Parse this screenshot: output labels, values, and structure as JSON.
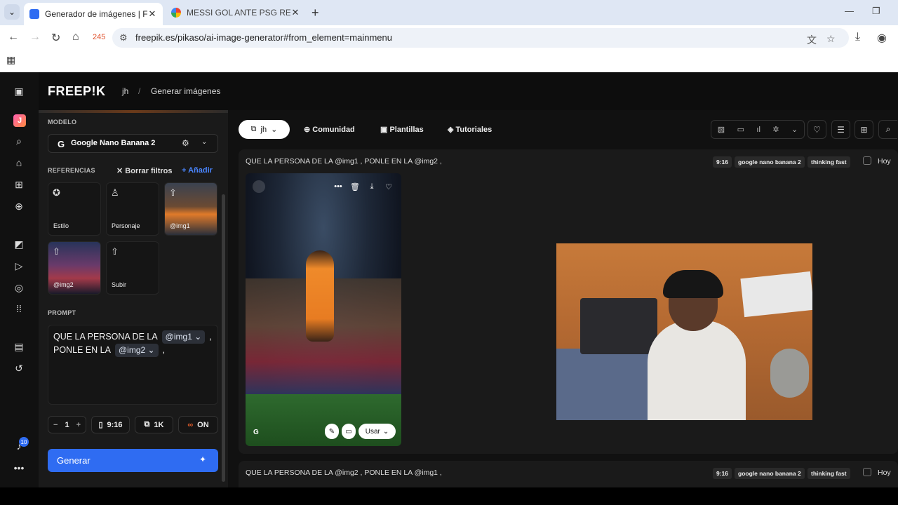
{
  "browser": {
    "tabs": [
      {
        "title": "Generador de imágenes | Freepik",
        "active": true
      },
      {
        "title": "MESSI GOL ANTE PSG REMONTADA",
        "active": false
      }
    ],
    "counter": "245",
    "url": "freepik.es/pikaso/ai-image-generator#from_element=mainmenu"
  },
  "header": {
    "logo": "FREEP!K",
    "breadcrumb": [
      "jh",
      "/",
      "Generar imágenes"
    ]
  },
  "rail": {
    "avatar_letter": "J",
    "notification_count": "10"
  },
  "panel": {
    "model_label": "MODELO",
    "model_icon": "G",
    "model_name": "Google Nano Banana 2",
    "references_label": "REFERENCIAS",
    "clear_filters": "Borrar filtros",
    "add": "Añadir",
    "reference_cards": [
      {
        "label": "Estilo",
        "icon": "star-icon"
      },
      {
        "label": "Personaje",
        "icon": "person-icon"
      },
      {
        "label": "@img1",
        "icon": "upload-icon"
      },
      {
        "label": "@img2",
        "icon": "upload-icon"
      },
      {
        "label": "Subir",
        "icon": "upload-icon"
      }
    ],
    "prompt_label": "PROMPT",
    "prompt": {
      "part1": "QUE LA PERSONA DE LA",
      "chip1": "@img1",
      "sep1": ",",
      "part2": "PONLE EN LA",
      "chip2": "@img2",
      "sep2": ","
    },
    "options": {
      "minus": "−",
      "count": "1",
      "plus": "+",
      "ratio": "9:16",
      "resolution": "1K",
      "infinite": "ON"
    },
    "generate_label": "Generar"
  },
  "main": {
    "workspace_pill": "jh",
    "nav": [
      "Comunidad",
      "Plantillas",
      "Tutoriales"
    ],
    "generations": [
      {
        "prompt": "QUE LA PERSONA DE LA @img1 , PONLE EN LA @img2 ,",
        "tags": [
          "9:16",
          "google nano banana 2",
          "thinking fast"
        ],
        "date": "Hoy",
        "image_action": "Usar"
      },
      {
        "prompt": "QUE LA PERSONA DE LA @img2 , PONLE EN LA @img1 ,",
        "tags": [
          "9:16",
          "google nano banana 2",
          "thinking fast"
        ],
        "date": "Hoy"
      }
    ]
  },
  "colors": {
    "accent": "#2f6cf2",
    "app_bg": "#111111",
    "panel_bg": "#1a1a1a",
    "infinite_icon": "#e25c2a"
  }
}
